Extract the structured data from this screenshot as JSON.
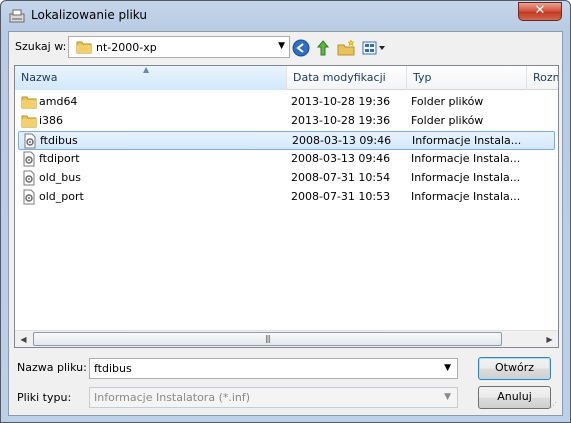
{
  "window": {
    "title": "Lokalizowanie pliku",
    "close_symbol": "✕"
  },
  "toolbar": {
    "look_in_label": "Szukaj w:",
    "look_in_value": "nt-2000-xp",
    "icons": [
      "back-icon",
      "up-folder-icon",
      "new-folder-icon",
      "views-menu-icon"
    ]
  },
  "list": {
    "columns": [
      "Nazwa",
      "Data modyfikacji",
      "Typ",
      "Rozn"
    ],
    "rows": [
      {
        "icon": "folder",
        "name": "amd64",
        "date": "2013-10-28 19:36",
        "type": "Folder plików",
        "selected": false
      },
      {
        "icon": "folder",
        "name": "i386",
        "date": "2013-10-28 19:36",
        "type": "Folder plików",
        "selected": false
      },
      {
        "icon": "inf",
        "name": "ftdibus",
        "date": "2008-03-13 09:46",
        "type": "Informacje Instala...",
        "selected": true
      },
      {
        "icon": "inf",
        "name": "ftdiport",
        "date": "2008-03-13 09:46",
        "type": "Informacje Instala...",
        "selected": false
      },
      {
        "icon": "inf",
        "name": "old_bus",
        "date": "2008-07-31 10:54",
        "type": "Informacje Instala...",
        "selected": false
      },
      {
        "icon": "inf",
        "name": "old_port",
        "date": "2008-07-31 10:53",
        "type": "Informacje Instala...",
        "selected": false
      }
    ]
  },
  "form": {
    "filename_label": "Nazwa pliku:",
    "filename_value": "ftdibus",
    "filetype_label": "Pliki typu:",
    "filetype_value": "Informacje Instalatora (*.inf)"
  },
  "buttons": {
    "open": "Otwórz",
    "cancel": "Anuluj"
  },
  "colors": {
    "selection_border": "#84acdd",
    "back_button": "#2d6fc4",
    "folder": "#e8c25a"
  }
}
